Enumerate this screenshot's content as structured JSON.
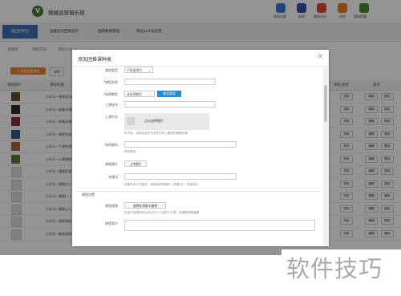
{
  "header": {
    "site_title": "微健运营俱乐部",
    "logo_letter": "V",
    "icons": [
      {
        "label": "帮助问题",
        "color": "#3a7bd5",
        "icon": "help-icon"
      },
      {
        "label": "新闻",
        "color": "#3f4fa8",
        "icon": "news-icon"
      },
      {
        "label": "最新活动",
        "color": "#d94a3a",
        "icon": "activity-icon"
      },
      {
        "label": "消息",
        "color": "#e47f2f",
        "icon": "message-icon"
      },
      {
        "label": "通知提醒",
        "color": "#4a8a35",
        "icon": "notice-icon"
      }
    ]
  },
  "subnav": {
    "back": "返回控制台",
    "items": [
      "运维首页回到首页",
      "团购数据管理",
      "微信公众号运营"
    ]
  },
  "tabs": [
    "直播类",
    "课程列表",
    "课程分类"
  ],
  "toolbar": {
    "add": "+ 添加团推课程",
    "sort": "排序"
  },
  "table": {
    "headers": [
      "课程图片",
      "课程标题",
      "课程",
      "排序",
      "操作"
    ],
    "rows": [
      {
        "title": "小羊马一课课堂3课程",
        "thumb": "#6a4a2a",
        "sort": "排序"
      },
      {
        "title": "小羊马一准备对课程(正)",
        "thumb": "#3a2a20",
        "sort": "排序"
      },
      {
        "title": "小羊马一准备对课程(一)",
        "thumb": "#8b2a3a",
        "sort": "排序"
      },
      {
        "title": "小羊马一课程完成课",
        "thumb": "#2a5a8a",
        "sort": "排序"
      },
      {
        "title": "小羊马一下课的课程",
        "thumb": "#b0653a",
        "sort": "排序"
      },
      {
        "title": "小羊马一上课课程课程",
        "thumb": "#5a7a3a",
        "sort": "排序"
      },
      {
        "title": "小羊马一课程好课",
        "thumb": "#ddd",
        "sort": "排序"
      },
      {
        "title": "小羊马一课程(二)",
        "thumb": "#ddd",
        "sort": "排序"
      },
      {
        "title": "小羊马一课程(一)",
        "thumb": "#ddd",
        "sort": "排序"
      },
      {
        "title": "小羊马一课程让儿上",
        "thumb": "#ddd",
        "sort": "排序"
      },
      {
        "title": "小羊马一课程课程课",
        "thumb": "#ddd",
        "sort": "排序"
      },
      {
        "title": "小羊马一最有用的课",
        "thumb": "#ddd",
        "sort": "排序"
      }
    ],
    "edit": "编辑",
    "delete": "删除"
  },
  "modal": {
    "title": "添加团推课种类",
    "close": "×",
    "course_type_label": "课程类型",
    "course_type_value": "不限量预约",
    "name_label": "*课程名称",
    "category_label": "*选择教室",
    "category_value": "请选择教室",
    "category_btn": "教室管理",
    "teacher_label": "上课技术",
    "cover_label": "上课时长",
    "upload_text": "点击选择图片",
    "upload_hint": "可不选，选择后会作为学员手机上看到的课程封面",
    "intro_label": "场所联系",
    "intro_hint": "场所联系",
    "pic_label": "课程图片",
    "pic_btn": "上传图片",
    "keyword_label": "关键词",
    "keyword_hint": "如果有多个关键词，请使用逗号隔开（关键词1，关键词2）",
    "section_label": "课程设置",
    "video_label": "课程视频",
    "video_btn": "选择在线推卡套餐",
    "video_hint": "在用户选择购买后可以在个人页的卡片里，填课程观看套餐",
    "intro2_label": "课程简介"
  },
  "watermark": "软件技巧"
}
